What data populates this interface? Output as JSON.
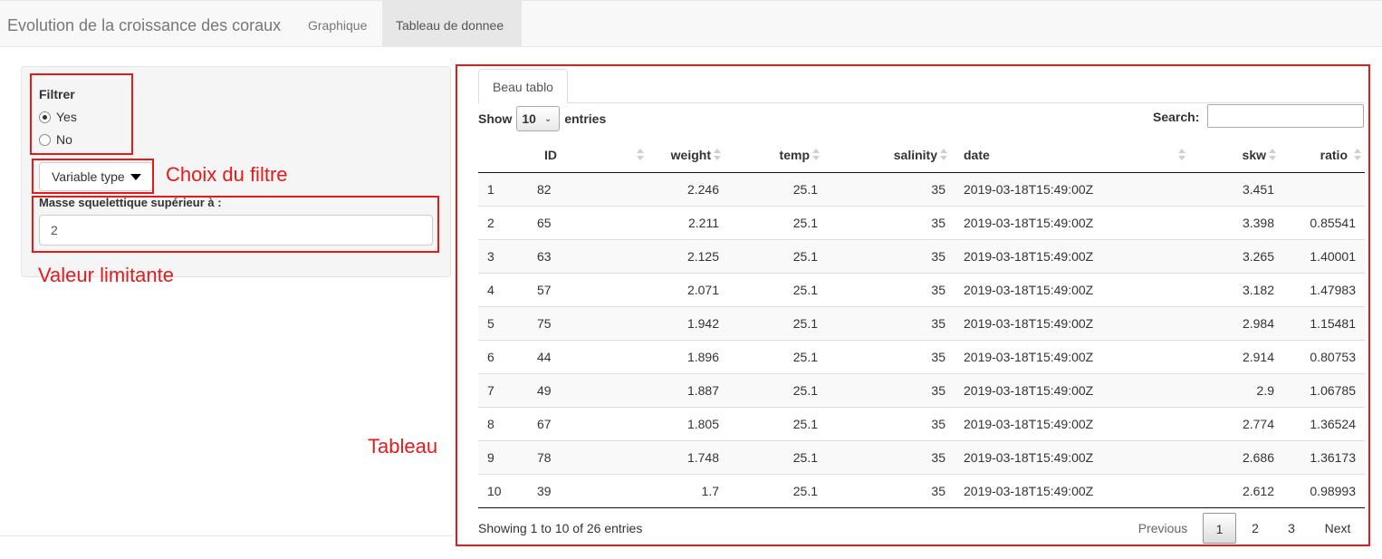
{
  "navbar": {
    "brand": "Evolution de la croissance des coraux",
    "tabs": [
      {
        "label": "Graphique",
        "active": false
      },
      {
        "label": "Tableau de donnee",
        "active": true
      }
    ]
  },
  "sidebar": {
    "filter_label": "Filtrer",
    "options": [
      {
        "label": "Yes",
        "checked": true
      },
      {
        "label": "No",
        "checked": false
      }
    ],
    "dropdown_label": "Variable type",
    "threshold_label": "Masse squelettique supérieur à :",
    "threshold_value": "2"
  },
  "annotations": {
    "filter_choice": "Choix du filtre",
    "limit_value": "Valeur limitante",
    "table": "Tableau",
    "color": "#e41b1b"
  },
  "main": {
    "tab_label": "Beau tablo",
    "show_label": "Show",
    "page_length": "10",
    "entries_label": "entries",
    "search_label": "Search:",
    "search_value": "",
    "columns": [
      "",
      "ID",
      "weight",
      "temp",
      "salinity",
      "date",
      "skw",
      "ratio"
    ],
    "rows": [
      [
        "1",
        "82",
        "2.246",
        "25.1",
        "35",
        "2019-03-18T15:49:00Z",
        "3.451",
        ""
      ],
      [
        "2",
        "65",
        "2.211",
        "25.1",
        "35",
        "2019-03-18T15:49:00Z",
        "3.398",
        "0.85541"
      ],
      [
        "3",
        "63",
        "2.125",
        "25.1",
        "35",
        "2019-03-18T15:49:00Z",
        "3.265",
        "1.40001"
      ],
      [
        "4",
        "57",
        "2.071",
        "25.1",
        "35",
        "2019-03-18T15:49:00Z",
        "3.182",
        "1.47983"
      ],
      [
        "5",
        "75",
        "1.942",
        "25.1",
        "35",
        "2019-03-18T15:49:00Z",
        "2.984",
        "1.15481"
      ],
      [
        "6",
        "44",
        "1.896",
        "25.1",
        "35",
        "2019-03-18T15:49:00Z",
        "2.914",
        "0.80753"
      ],
      [
        "7",
        "49",
        "1.887",
        "25.1",
        "35",
        "2019-03-18T15:49:00Z",
        "2.9",
        "1.06785"
      ],
      [
        "8",
        "67",
        "1.805",
        "25.1",
        "35",
        "2019-03-18T15:49:00Z",
        "2.774",
        "1.36524"
      ],
      [
        "9",
        "78",
        "1.748",
        "25.1",
        "35",
        "2019-03-18T15:49:00Z",
        "2.686",
        "1.36173"
      ],
      [
        "10",
        "39",
        "1.7",
        "25.1",
        "35",
        "2019-03-18T15:49:00Z",
        "2.612",
        "0.98993"
      ]
    ],
    "info": "Showing 1 to 10 of 26 entries",
    "pagination": {
      "previous": "Previous",
      "pages": [
        "1",
        "2",
        "3"
      ],
      "current": "1",
      "next": "Next"
    }
  }
}
